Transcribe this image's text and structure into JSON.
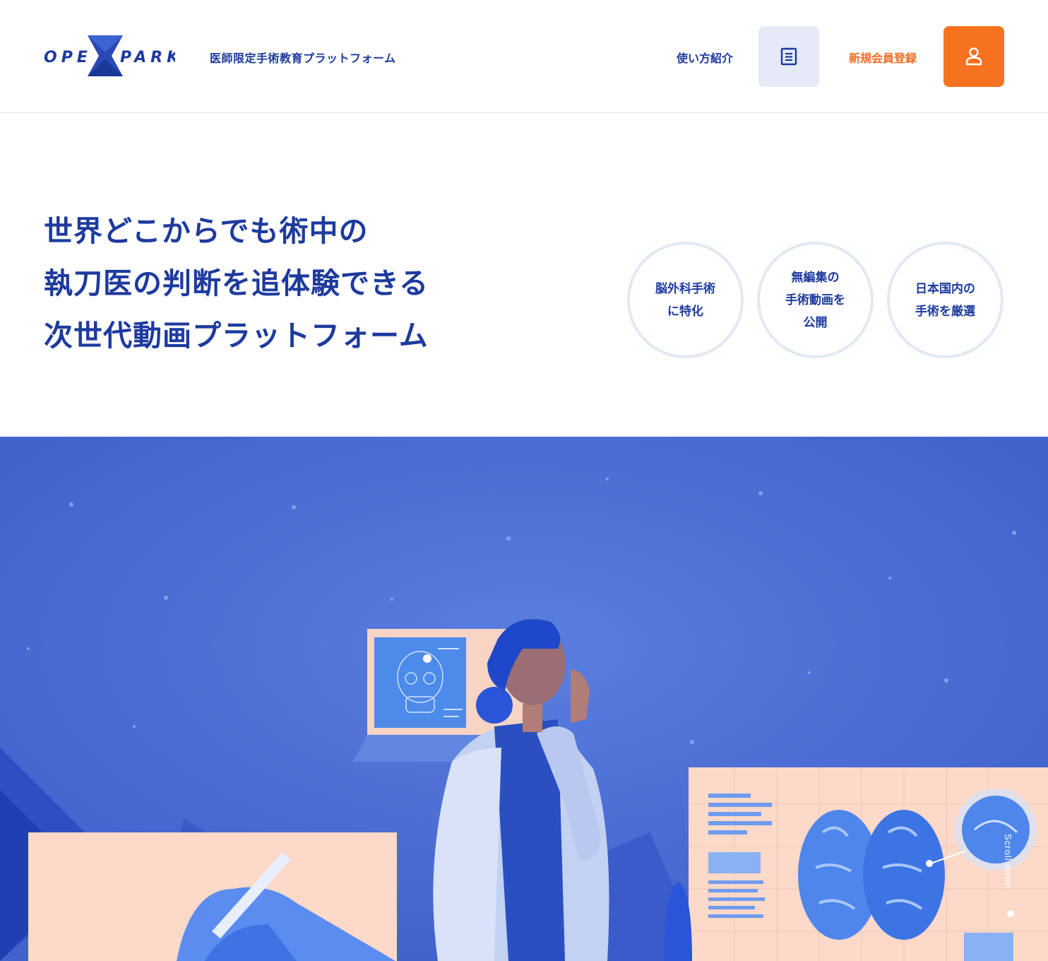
{
  "header": {
    "logo_text_left": "OPE",
    "logo_text_right": "PARK",
    "tagline": "医師限定手術教育プラットフォーム",
    "nav": {
      "guide_label": "使い方紹介",
      "guide_icon": "document-icon",
      "register_label": "新規会員登録",
      "register_icon": "user-icon"
    }
  },
  "hero": {
    "headline_lines": [
      "世界どこからでも術中の",
      "執刀医の判断を追体験できる",
      "次世代動画プラットフォーム"
    ],
    "features": [
      {
        "lines": [
          "脳外科手術",
          "に特化"
        ]
      },
      {
        "lines": [
          "無編集の",
          "手術動画を",
          "公開"
        ]
      },
      {
        "lines": [
          "日本国内の",
          "手術を厳選"
        ]
      }
    ]
  },
  "scroll": {
    "label": "Scroll down"
  },
  "colors": {
    "brand_navy": "#1d3a9e",
    "accent_orange": "#f7721f",
    "guide_button_bg": "#e5eaf6",
    "illustration_bg": "#4a6ad3",
    "panel_peach": "#fcd9c8"
  }
}
